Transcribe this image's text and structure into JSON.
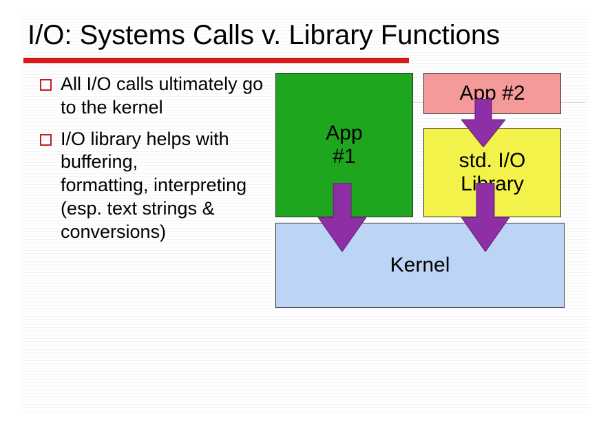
{
  "title": "I/O: Systems Calls v. Library Functions",
  "bullets": {
    "b1": "All I/O calls ultimately go to the kernel",
    "b2": "I/O library helps with buffering,\n formatting, interpreting\n (esp. text strings & conversions)"
  },
  "boxes": {
    "app1": "App\n#1",
    "app2": "App #2",
    "stdio": "std. I/O\nLibrary",
    "kernel": "Kernel"
  }
}
